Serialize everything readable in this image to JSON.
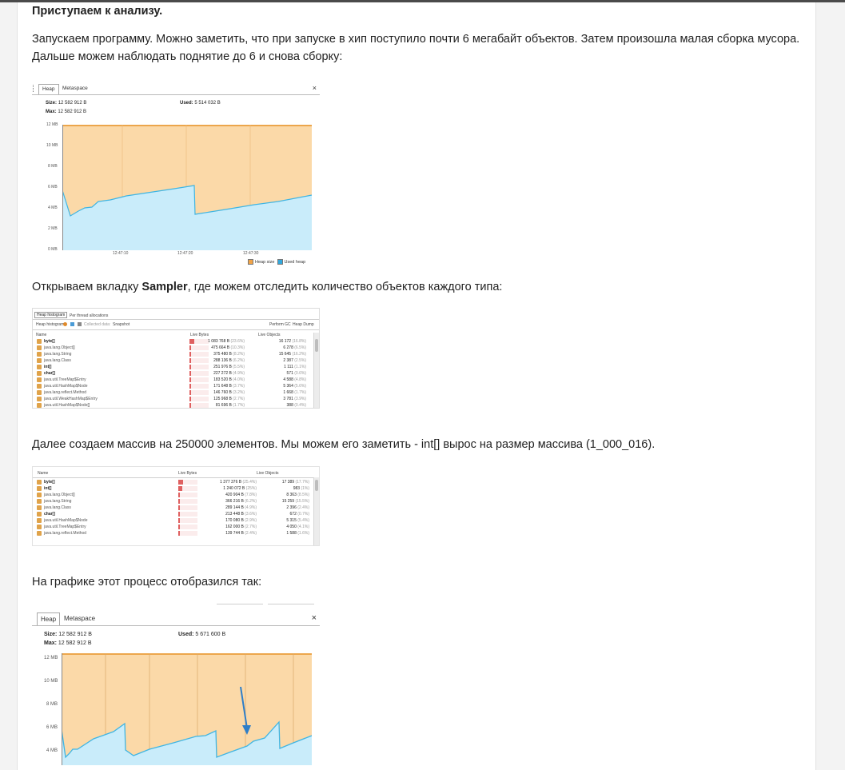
{
  "article": {
    "heading": "Приступаем к анализу.",
    "p1_line1": "Запускаем программу. Можно заметить, что при запуске в хип поступило почти 6 мегабайт объектов. Затем произошла малая сборка мусора.",
    "p1_line2": "Дальше можем наблюдать поднятие до 6 и снова сборку:",
    "p2_pre": "Открываем вкладку ",
    "p2_bold": "Sampler",
    "p2_post": ", где можем отследить количество объектов каждого типа:",
    "p3": "Далее создаем массив на 250000 элементов. Мы можем его заметить - int[] вырос на  размер массива (1_000_016).",
    "p4": "На графике этот процесс отобразился так:"
  },
  "heap1": {
    "tab_heap": "Heap",
    "tab_metaspace": "Metaspace",
    "close": "×",
    "size_label": "Size:",
    "size_value": "12 582 912 B",
    "max_label": "Max:",
    "max_value": "12 582 912 B",
    "used_label": "Used:",
    "used_value": "5 514 032 B",
    "y_ticks": [
      "12 MB",
      "10 MB",
      "8 MB",
      "6 MB",
      "4 MB",
      "2 MB",
      "0 MB"
    ],
    "x_ticks": [
      "12:47:10",
      "12:47:20",
      "12:47:30"
    ],
    "legend_heap": "Heap size",
    "legend_used": "Used heap"
  },
  "sampler1": {
    "toolbar_tab1": "Heap histogram",
    "toolbar_tab2": "Per thread allocations",
    "toolbar_label": "Heap histogram",
    "toolbar_snapshot": "Snapshot",
    "toolbar_collected": "Collected data:",
    "toolbar_right1": "Perform GC",
    "toolbar_right2": "Heap Dump",
    "col_name": "Name",
    "col_bytes": "Live Bytes",
    "col_objects": "Live Objects",
    "rows": [
      {
        "name": "byte[]",
        "bytes": "1 083 768 B",
        "pct": "(23.6%)",
        "objs": "16 172",
        "opct": "(16.8%)"
      },
      {
        "name": "java.lang.Object[]",
        "bytes": "475 664 B",
        "pct": "(10.3%)",
        "objs": "6 278",
        "opct": "(6.5%)"
      },
      {
        "name": "java.lang.String",
        "bytes": "375 480 B",
        "pct": "(8.2%)",
        "objs": "15 645",
        "opct": "(16.2%)"
      },
      {
        "name": "java.lang.Class",
        "bytes": "288 136 B",
        "pct": "(6.2%)",
        "objs": "2 387",
        "opct": "(2.5%)"
      },
      {
        "name": "int[]",
        "bytes": "251 976 B",
        "pct": "(5.5%)",
        "objs": "1 111",
        "opct": "(1.1%)"
      },
      {
        "name": "char[]",
        "bytes": "227 272 B",
        "pct": "(4.9%)",
        "objs": "571",
        "opct": "(0.6%)"
      },
      {
        "name": "java.util.TreeMap$Entry",
        "bytes": "183 520 B",
        "pct": "(4.0%)",
        "objs": "4 588",
        "opct": "(4.8%)"
      },
      {
        "name": "java.util.HashMap$Node",
        "bytes": "171 648 B",
        "pct": "(3.7%)",
        "objs": "5 364",
        "opct": "(5.6%)"
      },
      {
        "name": "java.lang.reflect.Method",
        "bytes": "146 760 B",
        "pct": "(3.2%)",
        "objs": "1 668",
        "opct": "(1.7%)"
      },
      {
        "name": "java.util.WeakHashMap$Entry",
        "bytes": "125 968 B",
        "pct": "(2.7%)",
        "objs": "3 781",
        "opct": "(3.9%)"
      },
      {
        "name": "java.util.HashMap$Node[]",
        "bytes": "81 696 B",
        "pct": "(1.7%)",
        "objs": "388",
        "opct": "(0.4%)"
      }
    ]
  },
  "sampler2": {
    "col_name": "Name",
    "col_bytes": "Live Bytes",
    "col_objects": "Live Objects",
    "rows": [
      {
        "name": "byte[]",
        "bytes": "1 377 376 B",
        "pct": "(25.4%)",
        "objs": "17 389",
        "opct": "(17.7%)"
      },
      {
        "name": "int[]",
        "bytes": "1 240 072 B",
        "pct": "(25%)",
        "objs": "983",
        "opct": "(1%)"
      },
      {
        "name": "java.lang.Object[]",
        "bytes": "420 904 B",
        "pct": "(7.8%)",
        "objs": "8 363",
        "opct": "(8.5%)"
      },
      {
        "name": "java.lang.String",
        "bytes": "366 216 B",
        "pct": "(6.2%)",
        "objs": "15 259",
        "opct": "(15.5%)"
      },
      {
        "name": "java.lang.Class",
        "bytes": "289 144 B",
        "pct": "(4.9%)",
        "objs": "2 396",
        "opct": "(2.4%)"
      },
      {
        "name": "char[]",
        "bytes": "213 448 B",
        "pct": "(3.6%)",
        "objs": "672",
        "opct": "(0.7%)"
      },
      {
        "name": "java.util.HashMap$Node",
        "bytes": "170 080 B",
        "pct": "(2.9%)",
        "objs": "5 315",
        "opct": "(5.4%)"
      },
      {
        "name": "java.util.TreeMap$Entry",
        "bytes": "162 000 B",
        "pct": "(2.7%)",
        "objs": "4 050",
        "opct": "(4.1%)"
      },
      {
        "name": "java.lang.reflect.Method",
        "bytes": "139 744 B",
        "pct": "(2.4%)",
        "objs": "1 588",
        "opct": "(1.6%)"
      }
    ]
  },
  "heap2": {
    "tab_heap": "Heap",
    "tab_metaspace": "Metaspace",
    "close": "×",
    "size_label": "Size:",
    "size_value": "12 582 912 B",
    "max_label": "Max:",
    "max_value": "12 582 912 B",
    "used_label": "Used:",
    "used_value": "5 671 600 B",
    "y_ticks": [
      "12 MB",
      "10 MB",
      "8 MB",
      "6 MB",
      "4 MB"
    ]
  },
  "colors": {
    "heap_fill": "#fbd9a8",
    "heap_line": "#e8962e",
    "used_fill": "#c9ecfa",
    "used_line": "#3fb5e3",
    "bar_red": "#e06060"
  }
}
